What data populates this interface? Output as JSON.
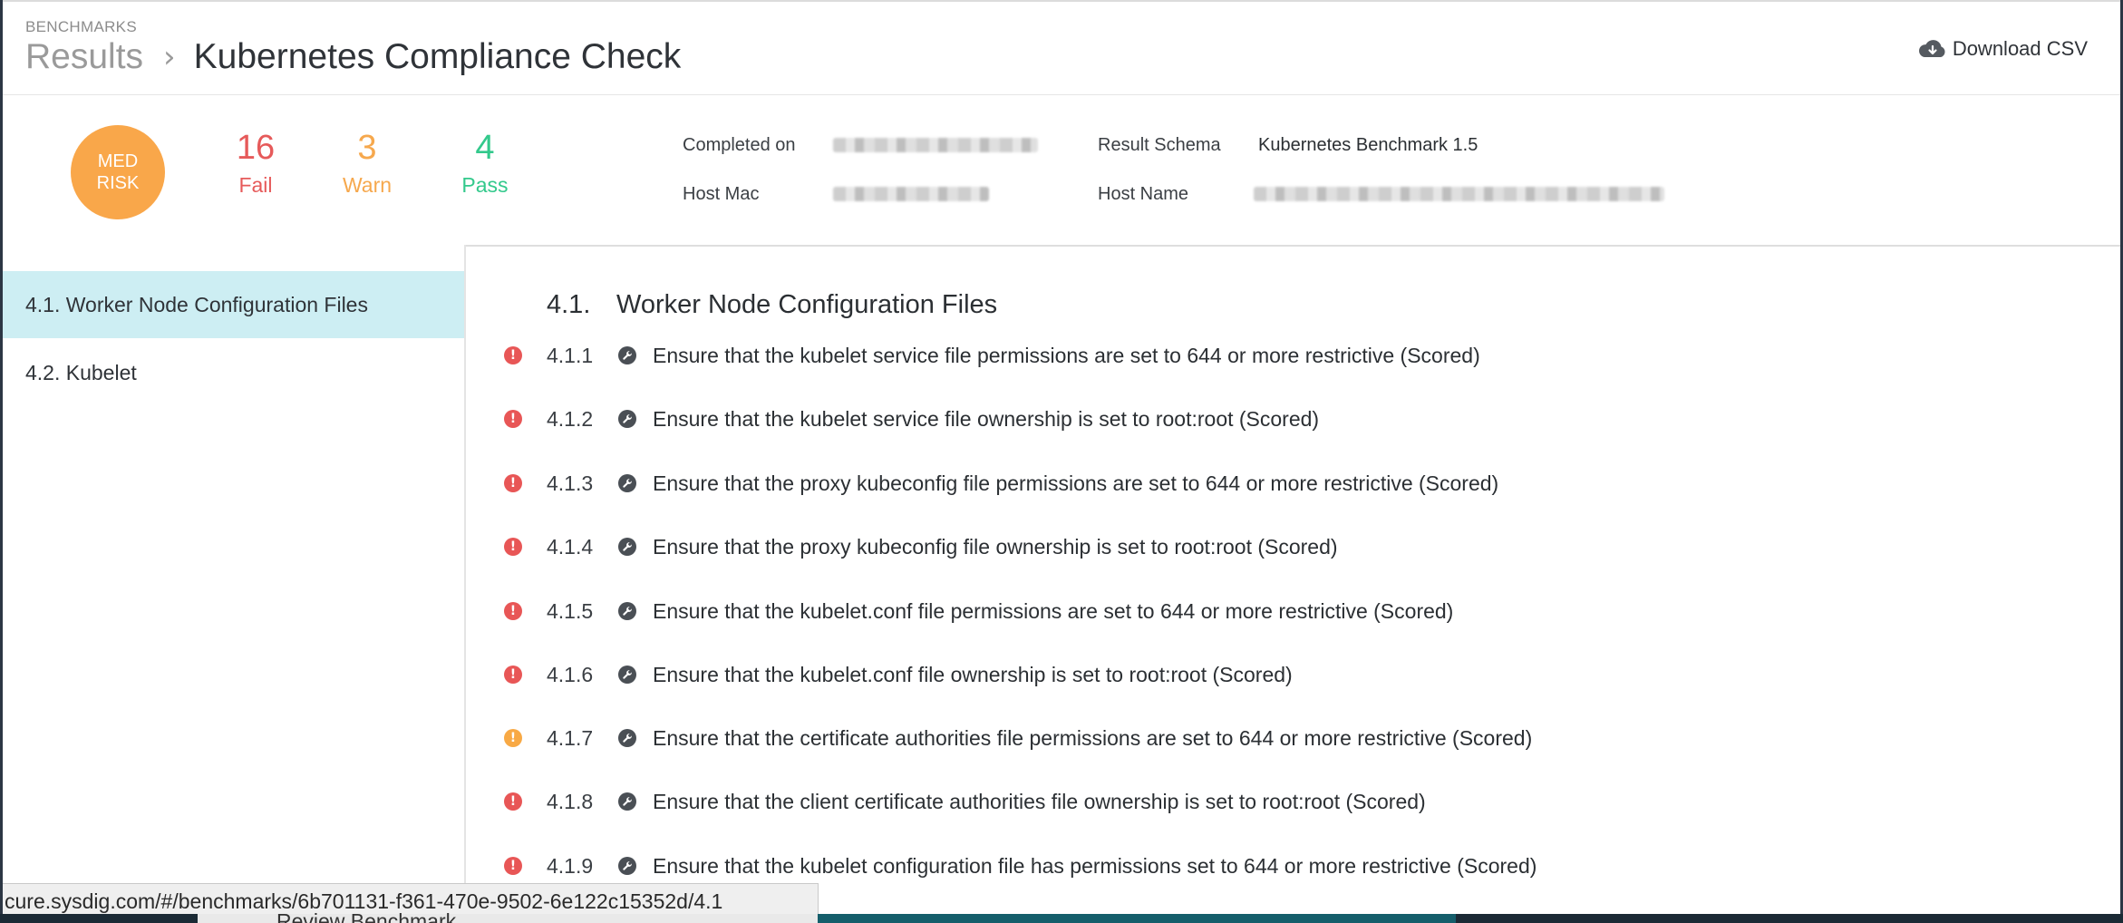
{
  "header": {
    "overline": "BENCHMARKS",
    "breadcrumb_root": "Results",
    "breadcrumb_sep": "›",
    "title": "Kubernetes Compliance Check",
    "download_label": "Download CSV"
  },
  "summary": {
    "risk_line1": "MED",
    "risk_line2": "RISK",
    "fail_count": "16",
    "fail_label": "Fail",
    "warn_count": "3",
    "warn_label": "Warn",
    "pass_count": "4",
    "pass_label": "Pass",
    "completed_label": "Completed on",
    "host_mac_label": "Host Mac",
    "schema_label": "Result Schema",
    "schema_value": "Kubernetes Benchmark 1.5",
    "host_name_label": "Host Name"
  },
  "sidebar": {
    "items": [
      {
        "label": "4.1. Worker Node Configuration Files",
        "active": true
      },
      {
        "label": "4.2. Kubelet",
        "active": false
      }
    ]
  },
  "content": {
    "section_number": "4.1.",
    "section_title": "Worker Node Configuration Files",
    "rows": [
      {
        "id": "4.1.1",
        "status": "fail",
        "text": "Ensure that the kubelet service file permissions are set to 644 or more restrictive (Scored)"
      },
      {
        "id": "4.1.2",
        "status": "fail",
        "text": "Ensure that the kubelet service file ownership is set to root:root (Scored)"
      },
      {
        "id": "4.1.3",
        "status": "fail",
        "text": "Ensure that the proxy kubeconfig file permissions are set to 644 or more restrictive (Scored)"
      },
      {
        "id": "4.1.4",
        "status": "fail",
        "text": "Ensure that the proxy kubeconfig file ownership is set to root:root (Scored)"
      },
      {
        "id": "4.1.5",
        "status": "fail",
        "text": "Ensure that the kubelet.conf file permissions are set to 644 or more restrictive (Scored)"
      },
      {
        "id": "4.1.6",
        "status": "fail",
        "text": "Ensure that the kubelet.conf file ownership is set to root:root (Scored)"
      },
      {
        "id": "4.1.7",
        "status": "warn",
        "text": "Ensure that the certificate authorities file permissions are set to 644 or more restrictive (Scored)"
      },
      {
        "id": "4.1.8",
        "status": "fail",
        "text": "Ensure that the client certificate authorities file ownership is set to root:root (Scored)"
      },
      {
        "id": "4.1.9",
        "status": "fail",
        "text": "Ensure that the kubelet configuration file has permissions set to 644 or more restrictive (Scored)"
      }
    ]
  },
  "statusbar": {
    "url": "cure.sysdig.com/#/benchmarks/6b701131-f361-470e-9502-6e122c15352d/4.1",
    "peek_text": "Review Benchmark"
  },
  "colors": {
    "fail": "#e65a5a",
    "warn": "#f6a84d",
    "pass": "#33c98c",
    "risk_badge": "#f9a74a",
    "active_nav": "#cdeef3"
  },
  "icons": {
    "download": "cloud-download-icon",
    "fail": "exclamation-circle-icon",
    "warn": "exclamation-circle-icon",
    "remediation": "wrench-icon"
  }
}
